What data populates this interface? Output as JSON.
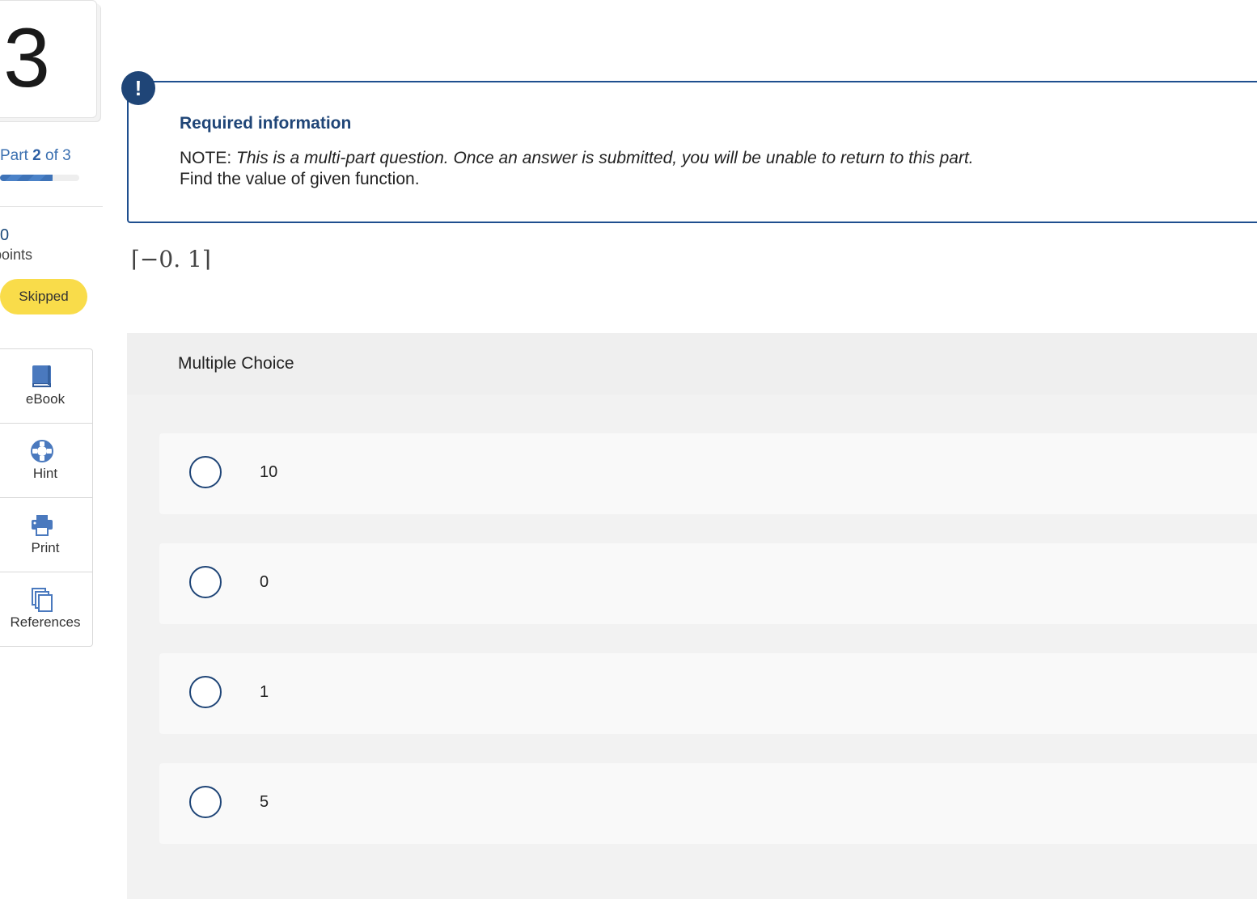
{
  "question": {
    "number": "3",
    "part_prefix": "Part",
    "part_current": "2",
    "part_suffix": "of 3",
    "part_progress_fraction": 0.667,
    "points_value": "0",
    "points_label": "points",
    "status": "Skipped"
  },
  "tools": [
    {
      "label": "eBook",
      "icon": "book-icon"
    },
    {
      "label": "Hint",
      "icon": "lifebuoy-icon"
    },
    {
      "label": "Print",
      "icon": "printer-icon"
    },
    {
      "label": "References",
      "icon": "documents-icon"
    }
  ],
  "required_info": {
    "alert_icon": "!",
    "title": "Required information",
    "note_prefix": "NOTE:",
    "note_text": "This is a multi-part question. Once an answer is submitted, you will be unable to return to this part.",
    "instruction": "Find the value of given function."
  },
  "expression": "⌈−0. 1⌉",
  "multiple_choice": {
    "title": "Multiple Choice",
    "options": [
      {
        "label": "10",
        "selected": false
      },
      {
        "label": "0",
        "selected": false
      },
      {
        "label": "1",
        "selected": false
      },
      {
        "label": "5",
        "selected": false
      }
    ]
  },
  "colors": {
    "accent": "#1f4577",
    "link": "#3a6fb0",
    "badge": "#f9dc4a"
  }
}
